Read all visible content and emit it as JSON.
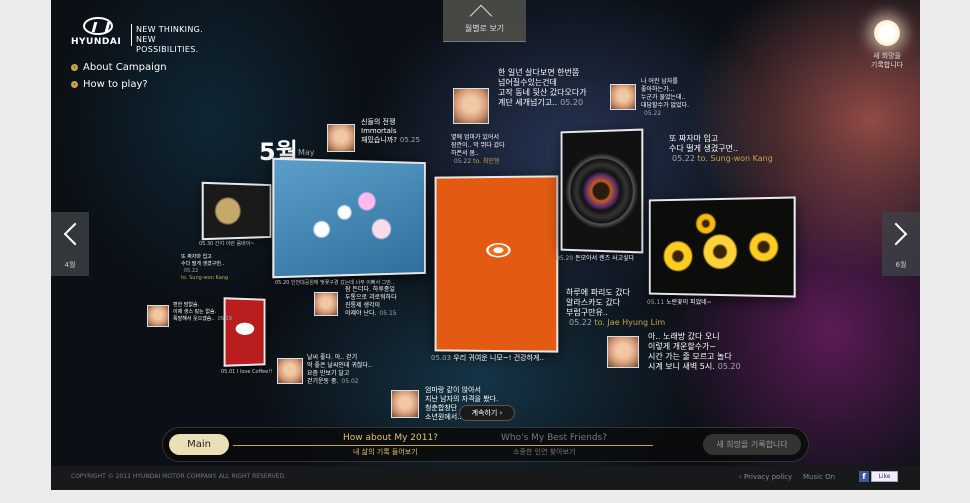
{
  "brand": {
    "name": "HYUNDAI",
    "slogan_line1": "NEW THINKING.",
    "slogan_line2": "NEW POSSIBILITIES."
  },
  "menu": {
    "about": "About Campaign",
    "howto": "How to play?"
  },
  "month_tab": {
    "label": "월별로 보기"
  },
  "wish_top": {
    "line1": "새 희망을",
    "line2": "기록합니다"
  },
  "nav": {
    "prev": "4월",
    "next": "6월"
  },
  "month": {
    "number": "5월",
    "english": "May"
  },
  "notes": [
    {
      "id": "n1",
      "lines": [
        "신들의 전쟁",
        "Immortals",
        "재밌습니까?"
      ],
      "date": "05.25"
    },
    {
      "id": "n2",
      "lines": [
        "한 일년 살다보면 한번쯤",
        "넘어질수있는건데",
        "고작 동네 뒷산 갔다오다가",
        "계단 세개넘기고.."
      ],
      "date": "05.20"
    },
    {
      "id": "n3",
      "lines": [
        "나 어린 남자를",
        "좋아하는가...",
        "누군가 물었는데..",
        "대답할수가 없었다."
      ],
      "date": "05.22"
    },
    {
      "id": "n4",
      "lines": [
        "옆에 엄마가 있어서",
        "잠깐이.. 막 뛰다 갔다",
        "하픈서 봄.."
      ],
      "date": "05.22",
      "to": "to. 최인형"
    },
    {
      "id": "n5",
      "lines": [
        "또 짜자마 입고",
        "수다 떨게 생겼구먼.."
      ],
      "date": "05.22",
      "to": "to. Sung-won Kang"
    },
    {
      "id": "n6",
      "lines": [
        "또 짜자마 입고",
        "수다 떨게 생겼구먼.."
      ],
      "date": "05.22",
      "to": "to. Sung-won Kang"
    },
    {
      "id": "n7",
      "lines": [
        "편한 맘없슴.",
        "이제 생스 탔는 없슴.",
        "폭발해서 웃으겠슴.."
      ],
      "date": "05.19"
    },
    {
      "id": "n8",
      "lines": [
        "잠 든더다. 하루종일",
        "두통으로 괴로워하다",
        "진통제 생각이",
        "이제야 난다."
      ],
      "date": "05.15"
    },
    {
      "id": "n9",
      "lines": [
        "날씨 좋다. 아.. 걷기",
        "딱 좋은 날씨인데 귀찮다..",
        "요즘 만보기 달고",
        "걷기운동 중."
      ],
      "date": "05.02"
    },
    {
      "id": "n10",
      "lines": [
        "하루에 파리도 갔다",
        "알라스카도 갔다",
        "부럽구만유.."
      ],
      "date": "05.22",
      "to": "to. Jae Hyung Lim"
    },
    {
      "id": "n11",
      "lines": [
        "아.. 노래방 갔다 오니",
        "이렇게 개운할수가~",
        "시간 가는 줄 모르고 놀다",
        "시계 보니 새벽 5시."
      ],
      "date": "05.20"
    },
    {
      "id": "n12",
      "lines": [
        "엄마랑 같이 앉아서",
        "지난 남자의 자격을 봤다.",
        "청춘합창단",
        "소년원에서.."
      ],
      "date": ""
    }
  ],
  "captions": {
    "blossom": "인천대공원에 벚꽃구경 갔는데 너무 이뻐서 그만..",
    "blossom_date": "05.20",
    "helmets": "간지 이런 음바이~",
    "helmets_date": "05.30",
    "coffee": "I love Coffee!!",
    "coffee_date": "05.01",
    "fish": "우리 귀여운 니모~! 건강하게..",
    "fish_date": "05.03",
    "lens": "돈모아서 렌즈 사고싶다",
    "lens_date": "05.20",
    "flowers": "노란꽃이 피었네~",
    "flowers_date": "05.11"
  },
  "more_button": "계속하기 ›",
  "bottom_bar": {
    "main": "Main",
    "item1_title": "How about My 2011?",
    "item1_sub": "내 삶의 기록 들어보기",
    "item2_title": "Who's My Best Friends?",
    "item2_sub": "소중한 인연 찾아보기",
    "wish": "새 희망을 기록합니다"
  },
  "footer": {
    "copyright": "COPYRIGHT © 2011 HYUNDAI MOTOR COMPANY. ALL RIGHT RESERVED.",
    "privacy": "› Privacy policy",
    "music": "Music On",
    "fb_icon": "f",
    "like": "Like"
  }
}
